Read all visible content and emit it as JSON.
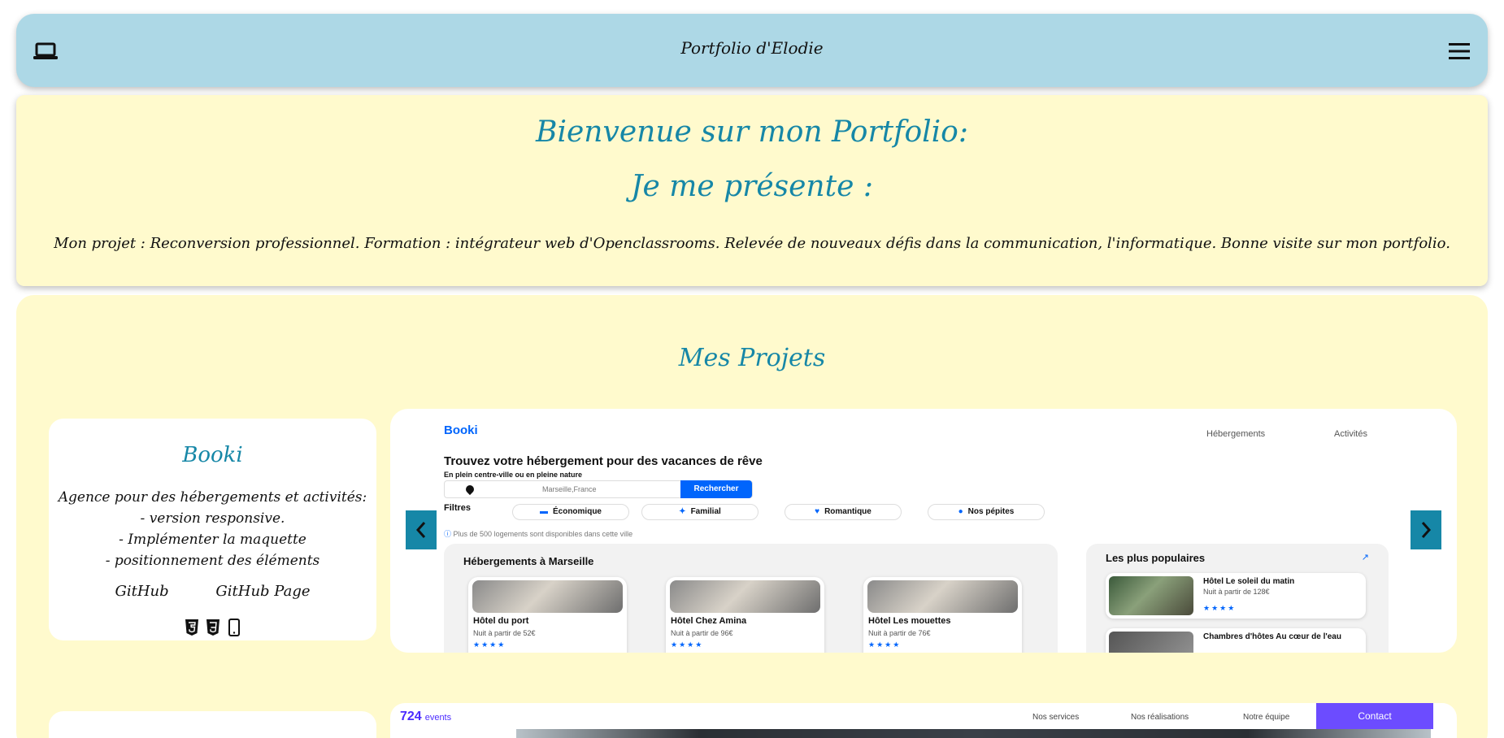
{
  "header": {
    "title": "Portfolio d'Elodie",
    "left_icon": "laptop-icon",
    "right_icon": "menu-icon"
  },
  "welcome": {
    "title": "Bienvenue sur mon Portfolio:",
    "subtitle": "Je me présente :",
    "text": "Mon projet : Reconversion professionnel. Formation : intégrateur web d'Openclassrooms. Relevée de nouveaux défis dans la communication, l'informatique. Bonne visite sur mon portfolio."
  },
  "projects": {
    "title": "Mes Projets",
    "items": [
      {
        "name": "Booki",
        "description": [
          "Agence pour des hébergements et activités:",
          "- version responsive.",
          "- Implémenter la maquette",
          "- positionnement des éléments"
        ],
        "links": [
          "GitHub",
          "GitHub Page"
        ],
        "techs": [
          "html5-icon",
          "css3-icon",
          "mobile-icon"
        ]
      }
    ]
  },
  "booki_preview": {
    "logo": "Booki",
    "nav": [
      "Hébergements",
      "Activités"
    ],
    "headline": "Trouvez votre hébergement pour des vacances de rêve",
    "subline": "En plein centre-ville ou en pleine nature",
    "search_value": "Marseille,France",
    "search_button": "Rechercher",
    "filters_label": "Filtres",
    "filters": [
      "Économique",
      "Familial",
      "Romantique",
      "Nos pépites"
    ],
    "info": "Plus de 500 logements sont disponibles dans cette ville",
    "section_title": "Hébergements à Marseille",
    "hotels": [
      {
        "name": "Hôtel du port",
        "price": "Nuit à partir de 52€"
      },
      {
        "name": "Hôtel Chez Amina",
        "price": "Nuit à partir de 96€"
      },
      {
        "name": "Hôtel Les mouettes",
        "price": "Nuit à partir de 76€"
      }
    ],
    "popular_title": "Les plus populaires",
    "popular": [
      {
        "name": "Hôtel Le soleil du matin",
        "price": "Nuit à partir de 128€"
      },
      {
        "name": "Chambres d'hôtes Au cœur de l'eau",
        "price": ""
      }
    ]
  },
  "events_preview": {
    "logo": "724",
    "logo_suffix": "events",
    "nav": [
      "Nos services",
      "Nos réalisations",
      "Notre équipe"
    ],
    "contact": "Contact"
  },
  "colors": {
    "header_bg": "#add8e6",
    "panel_bg": "#fffacd",
    "accent": "#1687a7",
    "booki_blue": "#0065fc"
  }
}
